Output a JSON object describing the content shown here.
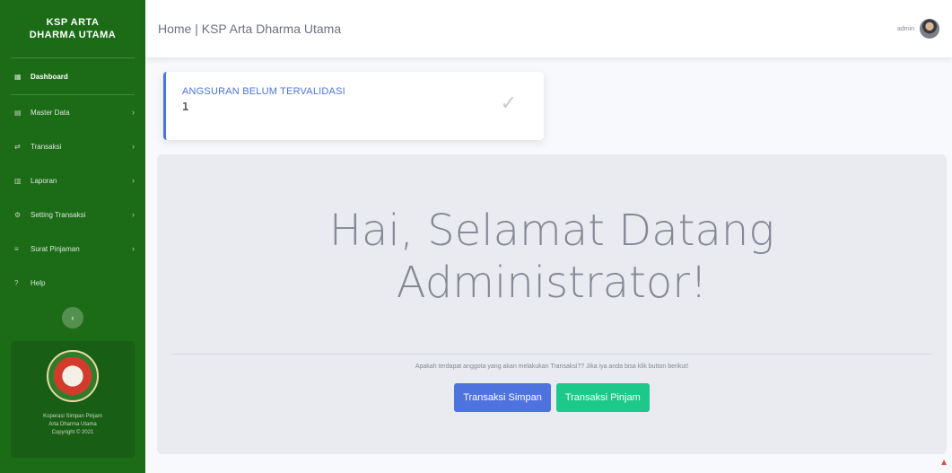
{
  "brand": {
    "line1": "KSP ARTA",
    "line2": "DHARMA UTAMA"
  },
  "sidebar": {
    "items": [
      {
        "label": "Dashboard",
        "icon": "dashboard-icon",
        "active": true,
        "chevron": ""
      },
      {
        "label": "Master Data",
        "icon": "grid-icon",
        "active": false,
        "chevron": "›"
      },
      {
        "label": "Transaksi",
        "icon": "exchange-icon",
        "active": false,
        "chevron": "›"
      },
      {
        "label": "Laporan",
        "icon": "report-icon",
        "active": false,
        "chevron": "›"
      },
      {
        "label": "Setting Transaksi",
        "icon": "gear-icon",
        "active": false,
        "chevron": "›"
      },
      {
        "label": "Surat Pinjaman",
        "icon": "list-icon",
        "active": false,
        "chevron": "›"
      },
      {
        "label": "Help",
        "icon": "question-icon",
        "active": false,
        "chevron": ""
      }
    ],
    "toggle_icon": "‹",
    "footer": {
      "line1": "Koperasi Simpan Pinjam",
      "line2": "Arta Dharma Utama",
      "line3": "Copyright © 2021"
    }
  },
  "topbar": {
    "title": "Home | KSP Arta Dharma Utama",
    "username": "admin"
  },
  "alert_card": {
    "title": "ANGSURAN BELUM TERVALIDASI",
    "value": "1"
  },
  "welcome": {
    "heading_line1": "Hai, Selamat Datang",
    "heading_line2": "Administrator!",
    "lead": "Apakah terdapat anggota yang akan melakukan Transaksi?? Jika iya anda bisa klik button berikut!",
    "btn_simpan": "Transaksi Simpan",
    "btn_pinjam": "Transaksi Pinjam"
  },
  "colors": {
    "sidebar": "#1c6b17",
    "primary": "#4e73df",
    "success": "#1cc88a"
  }
}
